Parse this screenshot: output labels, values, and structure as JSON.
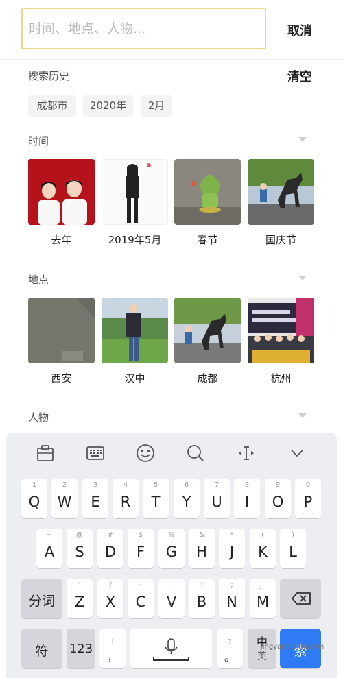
{
  "search": {
    "placeholder": "时间、地点、人物...",
    "cancel_label": "取消"
  },
  "history": {
    "title": "搜索历史",
    "clear_label": "清空",
    "chips": [
      "成都市",
      "2020年",
      "2月"
    ]
  },
  "sections": {
    "time": {
      "title": "时间",
      "items": [
        "去年",
        "2019年5月",
        "春节",
        "国庆节"
      ]
    },
    "place": {
      "title": "地点",
      "items": [
        "西安",
        "汉中",
        "成都",
        "杭州"
      ]
    },
    "people": {
      "title": "人物"
    }
  },
  "keyboard": {
    "toolbar_icons": [
      "clipboard-icon",
      "keyboard-icon",
      "emoji-icon",
      "search-icon",
      "cursor-icon",
      "chevron-down-icon"
    ],
    "row1": [
      {
        "sub": "1",
        "main": "Q"
      },
      {
        "sub": "2",
        "main": "W"
      },
      {
        "sub": "3",
        "main": "E"
      },
      {
        "sub": "4",
        "main": "R"
      },
      {
        "sub": "5",
        "main": "T"
      },
      {
        "sub": "6",
        "main": "Y"
      },
      {
        "sub": "7",
        "main": "U"
      },
      {
        "sub": "8",
        "main": "I"
      },
      {
        "sub": "9",
        "main": "O"
      },
      {
        "sub": "0",
        "main": "P"
      }
    ],
    "row2": [
      {
        "sub": "~",
        "main": "A"
      },
      {
        "sub": "@",
        "main": "S"
      },
      {
        "sub": "#",
        "main": "D"
      },
      {
        "sub": "$",
        "main": "F"
      },
      {
        "sub": "%",
        "main": "G"
      },
      {
        "sub": "&",
        "main": "H"
      },
      {
        "sub": "*",
        "main": "J"
      },
      {
        "sub": "(",
        "main": "K"
      },
      {
        "sub": ")",
        "main": "L"
      }
    ],
    "row3": [
      {
        "sub": "'",
        "main": "Z"
      },
      {
        "sub": "/",
        "main": "X"
      },
      {
        "sub": "-",
        "main": "C"
      },
      {
        "sub": "_",
        "main": "V"
      },
      {
        "sub": ":",
        "main": "B"
      },
      {
        "sub": ";",
        "main": "N"
      },
      {
        "sub": "、",
        "main": "M"
      }
    ],
    "fenci_label": "分词",
    "fu_label": "符",
    "num_label": "123",
    "comma_sub": "!",
    "comma_main": "，",
    "period_sub": "?",
    "period_main": "。",
    "zhong_label": "中",
    "ying_label": "英",
    "search_label": "索"
  },
  "watermark": "jingyan.baidu.com",
  "colors": {
    "search_border": "#f0d58a",
    "keyboard_bg": "#edeef2",
    "search_key": "#2f7bf6"
  }
}
